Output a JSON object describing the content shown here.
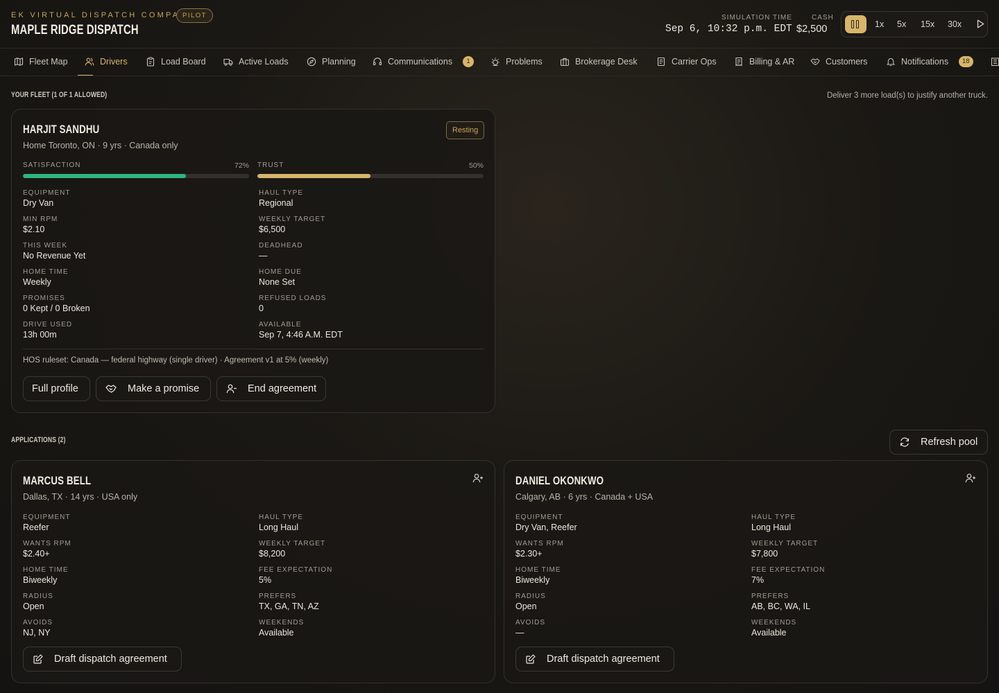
{
  "header": {
    "company": "EK VIRTUAL DISPATCH COMPANY",
    "tier_badge": "PILOT",
    "brand": "MAPLE RIDGE DISPATCH",
    "sim_time_label": "SIMULATION TIME",
    "sim_time": "Sep 6, 10:32 p.m. EDT",
    "cash_label": "CASH",
    "cash": "$2,500",
    "speeds": [
      "1x",
      "5x",
      "15x",
      "30x"
    ]
  },
  "nav": {
    "tabs": [
      {
        "label": "Fleet Map",
        "icon": "map-icon"
      },
      {
        "label": "Drivers",
        "icon": "users-icon",
        "active": true
      },
      {
        "label": "Load Board",
        "icon": "clipboard-icon"
      },
      {
        "label": "Active Loads",
        "icon": "truck-icon"
      },
      {
        "label": "Planning",
        "icon": "compass-icon"
      },
      {
        "label": "Communications",
        "icon": "headset-icon",
        "badge": "1"
      },
      {
        "label": "Problems",
        "icon": "alert-icon"
      },
      {
        "label": "Brokerage Desk",
        "icon": "briefcase-icon"
      },
      {
        "label": "Carrier Ops",
        "icon": "document-icon"
      },
      {
        "label": "Billing & AR",
        "icon": "receipt-icon"
      },
      {
        "label": "Customers",
        "icon": "handshake-icon"
      },
      {
        "label": "Notifications",
        "icon": "bell-icon",
        "badge": "18"
      }
    ]
  },
  "fleet": {
    "title": "YOUR FLEET (1 OF 1 ALLOWED)",
    "hint": "Deliver 3 more load(s) to justify another truck.",
    "driver": {
      "name": "HARJIT SANDHU",
      "status": "Resting",
      "subtitle": "Home Toronto, ON · 9 yrs · Canada only",
      "satisfaction_label": "SATISFACTION",
      "satisfaction_pct": "72%",
      "satisfaction_value": 72,
      "trust_label": "TRUST",
      "trust_pct": "50%",
      "trust_value": 50,
      "left_fields": [
        {
          "label": "EQUIPMENT",
          "value": "Dry Van"
        },
        {
          "label": "MIN RPM",
          "value": "$2.10"
        },
        {
          "label": "THIS WEEK",
          "value": "No Revenue Yet"
        },
        {
          "label": "HOME TIME",
          "value": "Weekly"
        },
        {
          "label": "PROMISES",
          "value": "0 Kept / 0 Broken"
        },
        {
          "label": "DRIVE USED",
          "value": "13h 00m"
        }
      ],
      "right_fields": [
        {
          "label": "HAUL TYPE",
          "value": "Regional"
        },
        {
          "label": "WEEKLY TARGET",
          "value": "$6,500"
        },
        {
          "label": "DEADHEAD",
          "value": "—"
        },
        {
          "label": "HOME DUE",
          "value": "None Set"
        },
        {
          "label": "REFUSED LOADS",
          "value": "0"
        },
        {
          "label": "AVAILABLE",
          "value": "Sep 7, 4:46 A.M. EDT"
        }
      ],
      "hos": "HOS ruleset: Canada — federal highway (single driver) · Agreement v1 at 5% (weekly)",
      "buttons": {
        "profile": "Full profile",
        "promise": "Make a promise",
        "end": "End agreement"
      }
    }
  },
  "applications": {
    "title": "APPLICATIONS (2)",
    "refresh": "Refresh pool",
    "draft_label": "Draft dispatch agreement",
    "items": [
      {
        "name": "MARCUS BELL",
        "subtitle": "Dallas, TX · 14 yrs · USA only",
        "left": [
          {
            "label": "EQUIPMENT",
            "value": "Reefer"
          },
          {
            "label": "WANTS RPM",
            "value": "$2.40+"
          },
          {
            "label": "HOME TIME",
            "value": "Biweekly"
          },
          {
            "label": "RADIUS",
            "value": "Open"
          },
          {
            "label": "AVOIDS",
            "value": "NJ, NY"
          }
        ],
        "right": [
          {
            "label": "HAUL TYPE",
            "value": "Long Haul"
          },
          {
            "label": "WEEKLY TARGET",
            "value": "$8,200"
          },
          {
            "label": "FEE EXPECTATION",
            "value": "5%"
          },
          {
            "label": "PREFERS",
            "value": "TX, GA, TN, AZ"
          },
          {
            "label": "WEEKENDS",
            "value": "Available"
          }
        ]
      },
      {
        "name": "DANIEL OKONKWO",
        "subtitle": "Calgary, AB · 6 yrs · Canada + USA",
        "left": [
          {
            "label": "EQUIPMENT",
            "value": "Dry Van, Reefer"
          },
          {
            "label": "WANTS RPM",
            "value": "$2.30+"
          },
          {
            "label": "HOME TIME",
            "value": "Biweekly"
          },
          {
            "label": "RADIUS",
            "value": "Open"
          },
          {
            "label": "AVOIDS",
            "value": "—"
          }
        ],
        "right": [
          {
            "label": "HAUL TYPE",
            "value": "Long Haul"
          },
          {
            "label": "WEEKLY TARGET",
            "value": "$7,800"
          },
          {
            "label": "FEE EXPECTATION",
            "value": "7%"
          },
          {
            "label": "PREFERS",
            "value": "AB, BC, WA, IL"
          },
          {
            "label": "WEEKENDS",
            "value": "Available"
          }
        ]
      }
    ]
  },
  "colors": {
    "accent": "#d8b56b",
    "satisfaction": "#2fb57e",
    "trust": "#d8b56b"
  }
}
